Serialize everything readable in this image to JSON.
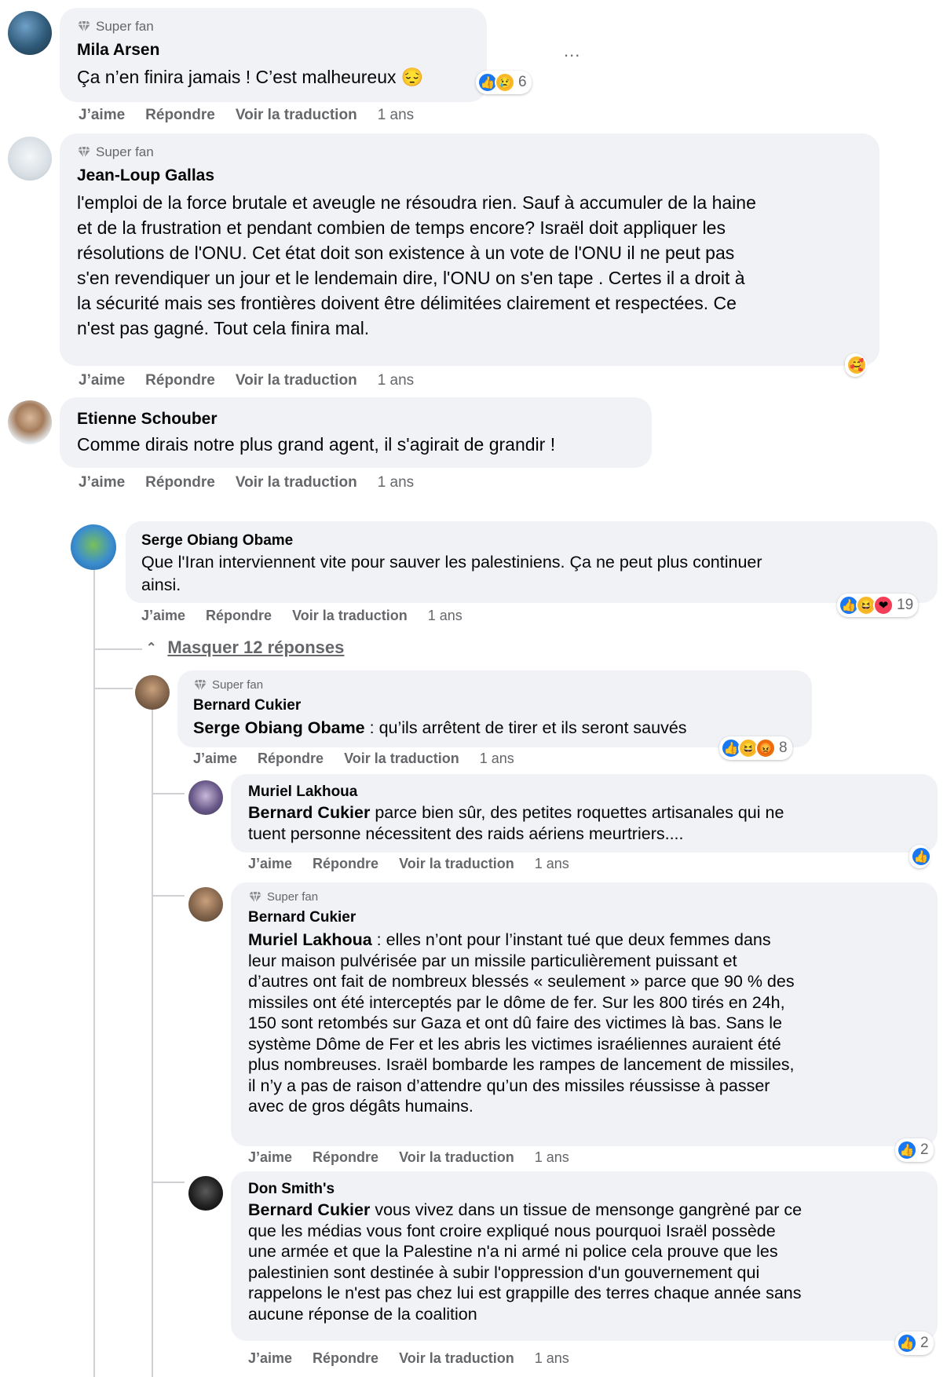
{
  "ui": {
    "superfan_label": "Super fan",
    "actions": {
      "like": "J’aime",
      "reply": "Répondre",
      "translate": "Voir la traduction"
    },
    "more_menu": "...",
    "hide_replies": "Masquer 12 réponses"
  },
  "comments": [
    {
      "author": "Mila Arsen",
      "superfan": true,
      "text": "Ça n’en finira jamais ! C’est malheureux 😔",
      "time": "1 ans",
      "reactions": [
        "like",
        "sad"
      ],
      "reaction_count": "6"
    },
    {
      "author": "Jean-Loup Gallas",
      "superfan": true,
      "lines": [
        "l'emploi de la force brutale et aveugle ne résoudra rien. Sauf à accumuler de la haine",
        "et de la frustration et pendant combien de temps encore? Israël doit appliquer les",
        "résolutions de l'ONU. Cet état doit son existence à un vote de l'ONU il ne peut pas",
        "s'en revendiquer un jour et le lendemain dire, l'ONU on s'en tape . Certes il a droit à",
        "la sécurité mais ses frontières doivent être délimitées clairement et respectées. Ce",
        "n'est pas gagné. Tout cela finira mal."
      ],
      "time": "1 ans",
      "reactions": [
        "care"
      ],
      "reaction_count": ""
    },
    {
      "author": "Etienne Schouber",
      "superfan": false,
      "text": "Comme dirais notre plus grand agent, il s'agirait de grandir !",
      "time": "1 ans"
    },
    {
      "author": "Serge Obiang Obame",
      "superfan": false,
      "lines": [
        "Que l'Iran interviennent vite pour sauver les palestiniens. Ça ne peut plus continuer",
        "ainsi."
      ],
      "time": "1 ans",
      "reactions": [
        "like",
        "haha",
        "love"
      ],
      "reaction_count": "19"
    }
  ],
  "replies": [
    {
      "author": "Bernard Cukier",
      "superfan": true,
      "mention": "Serge Obiang Obame",
      "lines": [
        " : qu’ils arrêtent de tirer et ils seront sauvés"
      ],
      "time": "1 ans",
      "reactions": [
        "like",
        "haha",
        "angry"
      ],
      "reaction_count": "8"
    },
    {
      "author": "Muriel Lakhoua",
      "superfan": false,
      "mention": "Bernard Cukier",
      "lines": [
        " parce bien sûr, des petites roquettes artisanales qui ne",
        "tuent personne nécessitent des raids aériens meurtriers...."
      ],
      "time": "1 ans",
      "reactions": [
        "like"
      ],
      "reaction_count": ""
    },
    {
      "author": "Bernard Cukier",
      "superfan": true,
      "mention": "Muriel Lakhoua",
      "lines": [
        " : elles n’ont pour l’instant tué que deux femmes dans",
        "leur maison pulvérisée par un missile particulièrement puissant et",
        "d’autres ont fait de nombreux blessés « seulement » parce que 90 % des",
        "missiles ont été interceptés par le dôme de fer. Sur les 800 tirés en 24h,",
        "150 sont retombés sur Gaza et ont dû faire des victimes là bas. Sans le",
        "système Dôme de Fer et les abris les victimes israéliennes auraient été",
        "plus nombreuses. Israël bombarde les rampes de lancement de missiles,",
        "il n’y a pas de raison d’attendre qu’un des missiles réussisse à passer",
        "avec de gros dégâts humains."
      ],
      "time": "1 ans",
      "reactions": [
        "like"
      ],
      "reaction_count": "2"
    },
    {
      "author": "Don Smith's",
      "superfan": false,
      "mention": "Bernard Cukier",
      "lines": [
        " vous vivez dans un tissue de mensonge gangrèné par ce",
        "que les médias vous font croire expliqué nous pourquoi Israël possède",
        "une armée et que la Palestine n'a ni armé ni police cela prouve que les",
        "palestinien sont destinée à subir l'oppression d'un gouvernement qui",
        "rappelons le n'est pas chez lui est grappille des terres chaque année sans",
        "aucune réponse de la coalition"
      ],
      "time": "1 ans",
      "reactions": [
        "like"
      ],
      "reaction_count": "2"
    }
  ]
}
